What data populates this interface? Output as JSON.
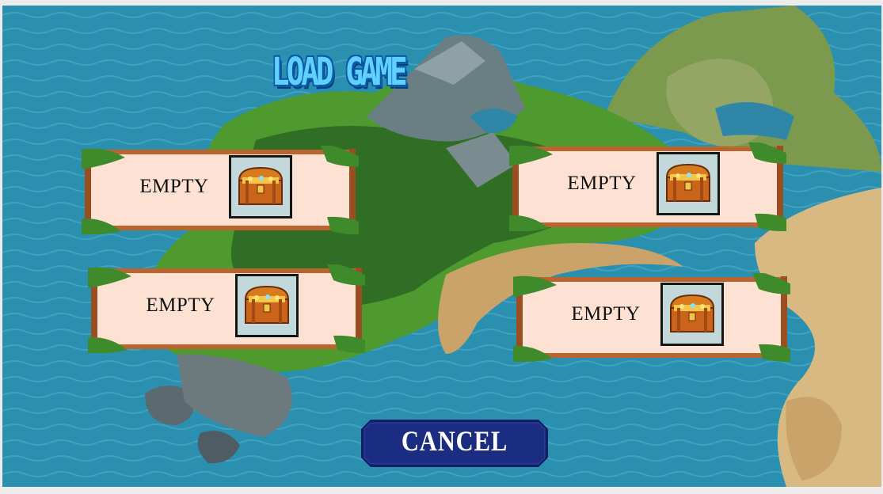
{
  "screen": {
    "title": "LOAD GAME",
    "save_slots": [
      {
        "label": "EMPTY",
        "icon": "treasure-chest-icon"
      },
      {
        "label": "EMPTY",
        "icon": "treasure-chest-icon"
      },
      {
        "label": "EMPTY",
        "icon": "treasure-chest-icon"
      },
      {
        "label": "EMPTY",
        "icon": "treasure-chest-icon"
      }
    ],
    "cancel_label": "CANCEL"
  },
  "colors": {
    "ocean": "#2b8fb0",
    "island_grass": "#4e9a2e",
    "slot_panel": "#fde2d4",
    "bamboo": "#b8652f",
    "cancel_button": "#0f1f66",
    "title_fill": "#5fd0ff",
    "title_outline": "#0a5aa8"
  }
}
